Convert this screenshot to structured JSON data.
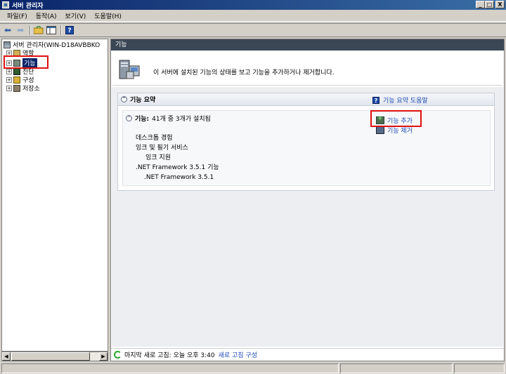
{
  "window": {
    "title": "서버 관리자",
    "buttons": {
      "minimize": "_",
      "maximize": "□",
      "close": "X"
    }
  },
  "menu": [
    "파일(F)",
    "동작(A)",
    "보기(V)",
    "도움말(H)"
  ],
  "tree": {
    "root": "서버 관리자(WIN-D18AVBBKO",
    "items": [
      {
        "label": "역할",
        "expander": "+"
      },
      {
        "label": "기능",
        "expander": "+",
        "selected": true
      },
      {
        "label": "진단",
        "expander": "+"
      },
      {
        "label": "구성",
        "expander": "+"
      },
      {
        "label": "저장소",
        "expander": "+"
      }
    ]
  },
  "scroll": {
    "left": "◀",
    "right": "▶"
  },
  "pane": {
    "header": "기능",
    "intro": "이 서버에 설치된 기능의 상태를 보고 기능을 추가하거나 제거합니다.",
    "section_title": "기능 요약",
    "help_link": "기능 요약 도움말",
    "summary_label": "기능:",
    "summary_value": "41개 중 3개가 설치됨",
    "features": [
      "데스크톱 경험",
      "잉크 및 필기 서비스",
      "잉크 지원",
      ".NET Framework 3.5.1 기능",
      ".NET Framework 3.5.1"
    ],
    "actions": {
      "add": "기능 추가",
      "remove": "기능 제거"
    },
    "collapse_glyph": "^"
  },
  "status": {
    "last_refresh": "마지막 새로 고침: 오늘 오후 3:40",
    "refresh_link": "새로 고침 구성"
  },
  "colors": {
    "title_bar": "#0a246a",
    "pane_header": "#3b4754",
    "link": "#1d49b5",
    "highlight_box": "#e01010"
  }
}
